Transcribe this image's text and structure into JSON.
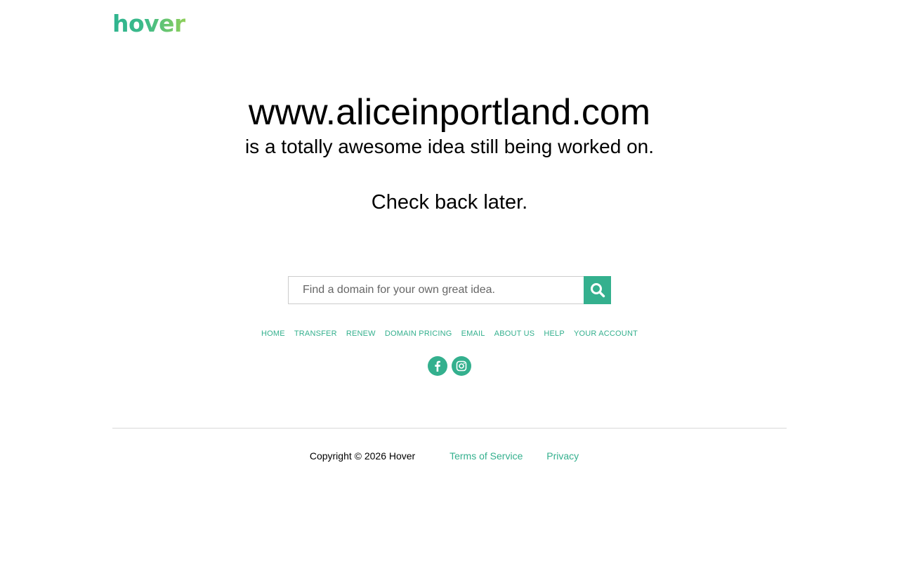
{
  "brand": {
    "logo_text": "hover",
    "accent_color": "#34b08e",
    "gradient_end_color": "#8fcf5a"
  },
  "hero": {
    "domain": "www.aliceinportland.com",
    "tagline": "is a totally awesome idea still being worked on.",
    "check_back": "Check back later."
  },
  "search": {
    "placeholder": "Find a domain for your own great idea.",
    "value": "",
    "button_icon": "search-icon"
  },
  "nav": {
    "items": [
      {
        "label": "HOME"
      },
      {
        "label": "TRANSFER"
      },
      {
        "label": "RENEW"
      },
      {
        "label": "DOMAIN PRICING"
      },
      {
        "label": "EMAIL"
      },
      {
        "label": "ABOUT US"
      },
      {
        "label": "HELP"
      },
      {
        "label": "YOUR ACCOUNT"
      }
    ]
  },
  "social": {
    "icons": [
      "facebook-icon",
      "instagram-icon"
    ]
  },
  "footer": {
    "copyright": "Copyright © 2026 Hover",
    "terms_label": "Terms of Service",
    "privacy_label": "Privacy"
  }
}
